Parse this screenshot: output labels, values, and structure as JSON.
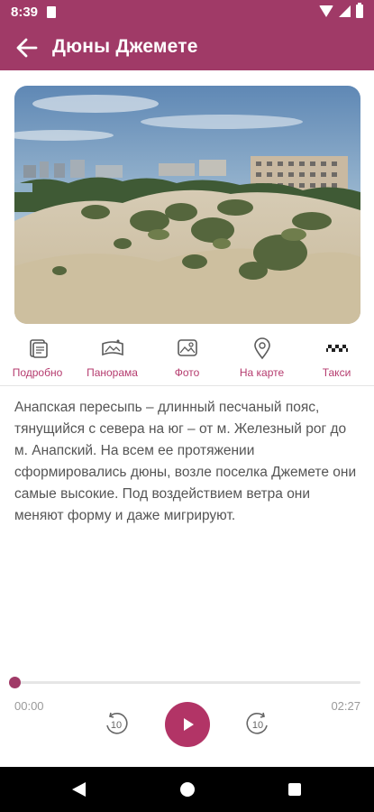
{
  "status_bar": {
    "time": "8:39"
  },
  "header": {
    "title": "Дюны Джемете",
    "back_icon": "arrow-left-icon",
    "color": "#a03a67"
  },
  "tabs": [
    {
      "label": "Подробно",
      "icon": "document-icon"
    },
    {
      "label": "Панорама",
      "icon": "panorama-icon"
    },
    {
      "label": "Фото",
      "icon": "photo-icon"
    },
    {
      "label": "На карте",
      "icon": "map-pin-icon"
    },
    {
      "label": "Такси",
      "icon": "taxi-icon"
    }
  ],
  "description": "Анапская пересыпь – длинный песчаный пояс, тянущийся с севера на юг – от м. Железный рог до м. Анапский. На всем ее протяжении сформировались дюны, возле поселка Джемете они самые высокие. Под воздействием ветра они меняют форму и даже мигрируют.",
  "player": {
    "current_time": "00:00",
    "total_time": "02:27",
    "progress": 0,
    "rewind_label": "10",
    "forward_label": "10",
    "accent": "#b23466"
  }
}
